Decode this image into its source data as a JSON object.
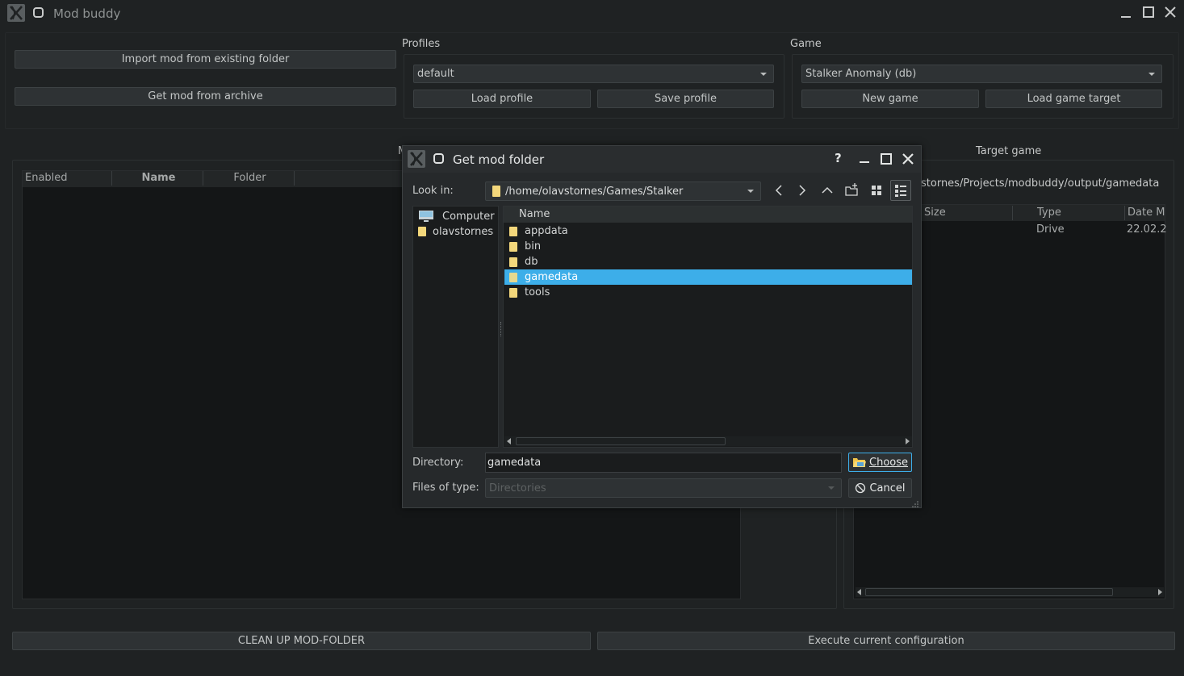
{
  "window": {
    "title": "Mod buddy"
  },
  "top": {
    "import_btn": "Import mod from existing folder",
    "archive_btn": "Get mod from archive"
  },
  "profiles": {
    "label": "Profiles",
    "selected": "default",
    "load_btn": "Load profile",
    "save_btn": "Save profile"
  },
  "game": {
    "label": "Game",
    "selected": "Stalker Anomaly (db)",
    "new_btn": "New game",
    "load_target_btn": "Load game target"
  },
  "mods_table": {
    "partial_label": "M",
    "columns": [
      "Enabled",
      "Name",
      "Folder"
    ]
  },
  "target": {
    "label": "Target game",
    "path": "stornes/Projects/modbuddy/output/gamedata",
    "columns": [
      "Size",
      "Type",
      "Date M"
    ],
    "rows": [
      {
        "type": "Drive",
        "date": "22.02.2"
      }
    ]
  },
  "bottom": {
    "cleanup_btn": "CLEAN UP MOD-FOLDER",
    "execute_btn": "Execute current configuration"
  },
  "dialog": {
    "title": "Get mod folder",
    "look_in_label": "Look in:",
    "look_in_path": "/home/olavstornes/Games/Stalker",
    "sidebar": [
      "Computer",
      "olavstornes"
    ],
    "list_header": "Name",
    "items": [
      "appdata",
      "bin",
      "db",
      "gamedata",
      "tools"
    ],
    "selected_index": 3,
    "directory_label": "Directory:",
    "directory_value": "gamedata",
    "files_type_label": "Files of type:",
    "files_type_value": "Directories",
    "choose_btn": "Choose",
    "cancel_btn": "Cancel"
  },
  "colors": {
    "background": "#1f2223",
    "selection": "#3daee9",
    "folder": "#f3d77b"
  }
}
